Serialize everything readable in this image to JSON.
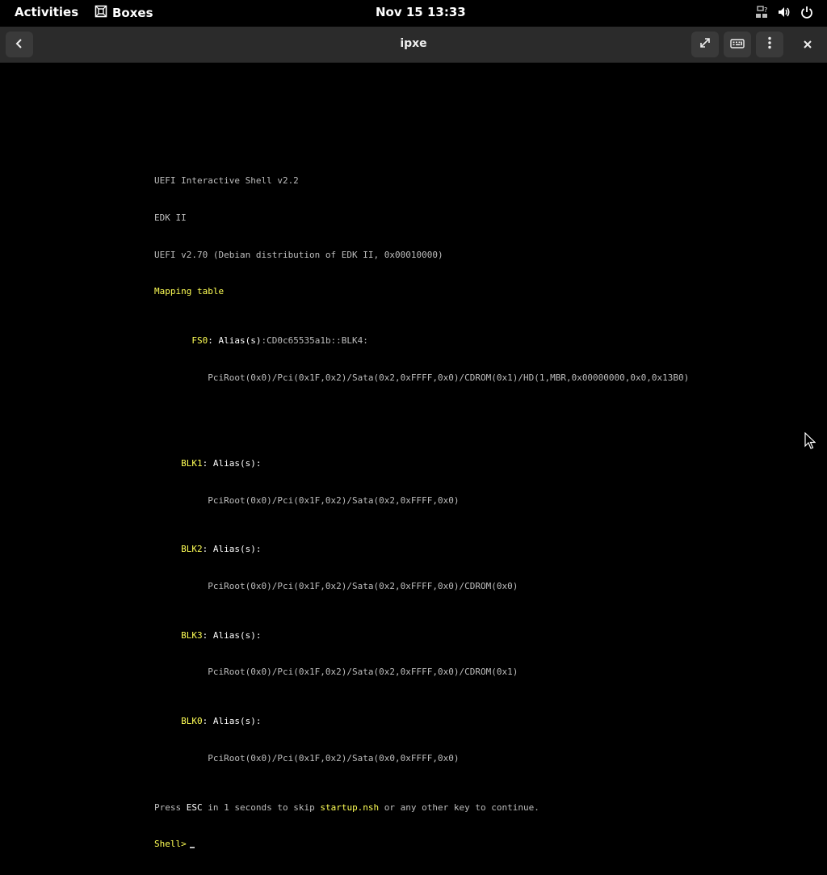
{
  "topbar": {
    "activities": "Activities",
    "app_name": "Boxes",
    "clock": "Nov 15  13:33"
  },
  "headerbar": {
    "title": "ipxe"
  },
  "console": {
    "lines": {
      "l1": "UEFI Interactive Shell v2.2",
      "l2": "EDK II",
      "l3": "UEFI v2.70 (Debian distribution of EDK II, 0x00010000)",
      "l4": "Mapping table",
      "fs0_name": "FS0",
      "fs0_alias": ": Alias(s)",
      "fs0_alias_val": ":CD0c65535a1b::BLK4:",
      "fs0_path": "PciRoot(0x0)/Pci(0x1F,0x2)/Sata(0x2,0xFFFF,0x0)/CDROM(0x1)/HD(1,MBR,0x00000000,0x0,0x13B0)",
      "blk1_name": "BLK1",
      "blk1_alias": ": Alias(s)",
      "blk1_alias_val": ":",
      "blk1_path": "PciRoot(0x0)/Pci(0x1F,0x2)/Sata(0x2,0xFFFF,0x0)",
      "blk2_name": "BLK2",
      "blk2_alias": ": Alias(s)",
      "blk2_alias_val": ":",
      "blk2_path": "PciRoot(0x0)/Pci(0x1F,0x2)/Sata(0x2,0xFFFF,0x0)/CDROM(0x0)",
      "blk3_name": "BLK3",
      "blk3_alias": ": Alias(s)",
      "blk3_alias_val": ":",
      "blk3_path": "PciRoot(0x0)/Pci(0x1F,0x2)/Sata(0x2,0xFFFF,0x0)/CDROM(0x1)",
      "blk0_name": "BLK0",
      "blk0_alias": ": Alias(s)",
      "blk0_alias_val": ":",
      "blk0_path": "PciRoot(0x0)/Pci(0x1F,0x2)/Sata(0x0,0xFFFF,0x0)",
      "press_1": "Press ",
      "press_esc": "ESC",
      "press_2": " in 1 seconds to skip ",
      "press_nsh": "startup.nsh",
      "press_3": " or any other key to continue.",
      "prompt": "Shell>"
    }
  },
  "colors": {
    "highlight": "#ffff55",
    "console_text": "#bdbdbd",
    "headerbar_bg": "#2b2b2b"
  },
  "icons": {
    "app": "boxes-icon",
    "tray": [
      "network-unknown-icon",
      "volume-icon",
      "power-icon"
    ],
    "header": [
      "back-icon",
      "fullscreen-icon",
      "keyboard-icon",
      "menu-icon",
      "close-icon"
    ]
  }
}
